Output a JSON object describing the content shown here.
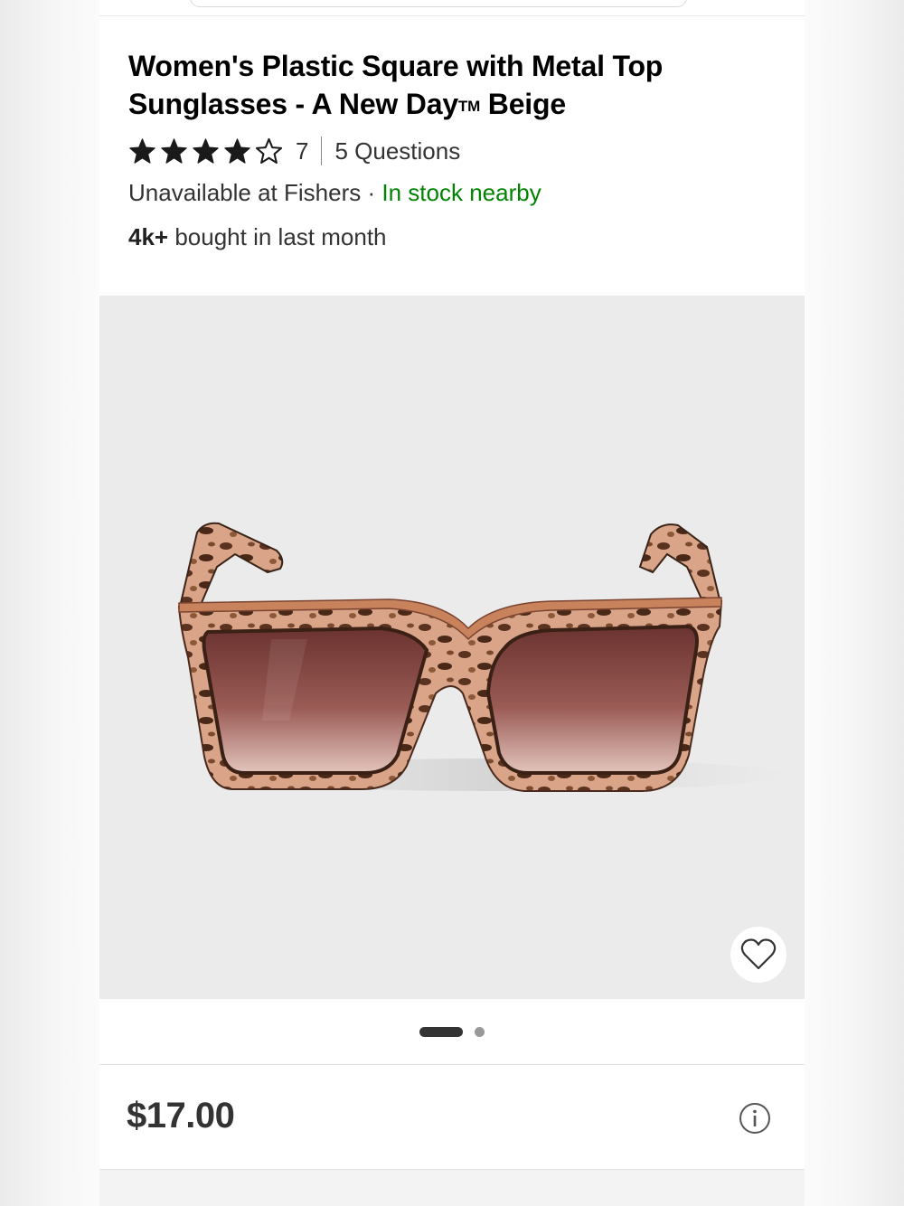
{
  "product": {
    "title_main": "Women's Plastic Square with Metal Top Sunglasses - A New Day",
    "title_tm": "TM",
    "title_color": "Beige",
    "rating_value": 4,
    "rating_max": 5,
    "rating_count": "7",
    "questions": "5 Questions",
    "availability_store": "Unavailable at Fishers",
    "availability_sep": "·",
    "availability_nearby": "In stock nearby",
    "bought_count": "4k+",
    "bought_text": "bought in last month",
    "price": "$17.00"
  },
  "gallery": {
    "total_images": 2,
    "active_index": 1
  },
  "icons": {
    "star_filled": "star-icon",
    "star_empty": "star-outline-icon",
    "favorite": "heart-icon",
    "info": "info-icon"
  },
  "colors": {
    "in_stock_green": "#008300",
    "text": "#333333",
    "image_background": "#ebebeb"
  }
}
